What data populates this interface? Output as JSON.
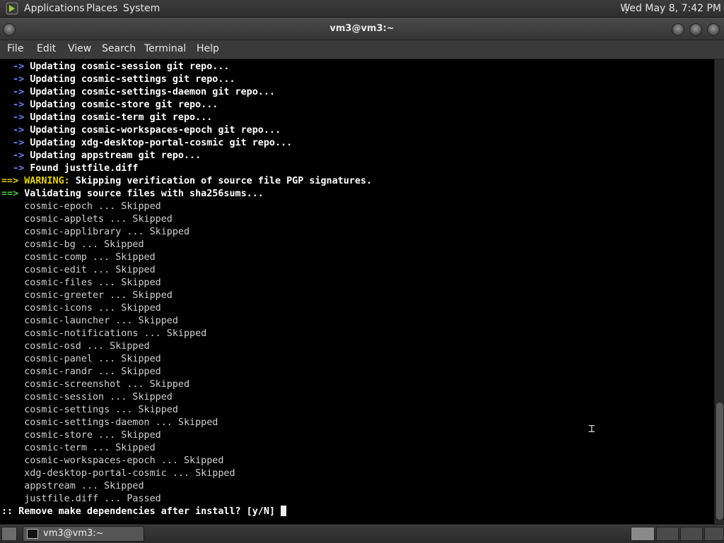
{
  "top_panel": {
    "menus": [
      "Applications",
      "Places",
      "System"
    ],
    "clock": "Wed May 8, 7:42 PM"
  },
  "window": {
    "title": "vm3@vm3:~",
    "menubar": [
      "File",
      "Edit",
      "View",
      "Search",
      "Terminal",
      "Help"
    ]
  },
  "terminal": {
    "lines": [
      {
        "kind": "arrow",
        "prefix": "  -> ",
        "text": "Updating cosmic-session git repo..."
      },
      {
        "kind": "arrow",
        "prefix": "  -> ",
        "text": "Updating cosmic-settings git repo..."
      },
      {
        "kind": "arrow",
        "prefix": "  -> ",
        "text": "Updating cosmic-settings-daemon git repo..."
      },
      {
        "kind": "arrow",
        "prefix": "  -> ",
        "text": "Updating cosmic-store git repo..."
      },
      {
        "kind": "arrow",
        "prefix": "  -> ",
        "text": "Updating cosmic-term git repo..."
      },
      {
        "kind": "arrow",
        "prefix": "  -> ",
        "text": "Updating cosmic-workspaces-epoch git repo..."
      },
      {
        "kind": "arrow",
        "prefix": "  -> ",
        "text": "Updating xdg-desktop-portal-cosmic git repo..."
      },
      {
        "kind": "arrow",
        "prefix": "  -> ",
        "text": "Updating appstream git repo..."
      },
      {
        "kind": "arrow",
        "prefix": "  -> ",
        "text": "Found justfile.diff"
      },
      {
        "kind": "warning",
        "prefix": "==> ",
        "label": "WARNING:",
        "text": " Skipping verification of source file PGP signatures."
      },
      {
        "kind": "green",
        "prefix": "==> ",
        "text": "Validating source files with sha256sums..."
      },
      {
        "kind": "plain",
        "text": "    cosmic-epoch ... Skipped"
      },
      {
        "kind": "plain",
        "text": "    cosmic-applets ... Skipped"
      },
      {
        "kind": "plain",
        "text": "    cosmic-applibrary ... Skipped"
      },
      {
        "kind": "plain",
        "text": "    cosmic-bg ... Skipped"
      },
      {
        "kind": "plain",
        "text": "    cosmic-comp ... Skipped"
      },
      {
        "kind": "plain",
        "text": "    cosmic-edit ... Skipped"
      },
      {
        "kind": "plain",
        "text": "    cosmic-files ... Skipped"
      },
      {
        "kind": "plain",
        "text": "    cosmic-greeter ... Skipped"
      },
      {
        "kind": "plain",
        "text": "    cosmic-icons ... Skipped"
      },
      {
        "kind": "plain",
        "text": "    cosmic-launcher ... Skipped"
      },
      {
        "kind": "plain",
        "text": "    cosmic-notifications ... Skipped"
      },
      {
        "kind": "plain",
        "text": "    cosmic-osd ... Skipped"
      },
      {
        "kind": "plain",
        "text": "    cosmic-panel ... Skipped"
      },
      {
        "kind": "plain",
        "text": "    cosmic-randr ... Skipped"
      },
      {
        "kind": "plain",
        "text": "    cosmic-screenshot ... Skipped"
      },
      {
        "kind": "plain",
        "text": "    cosmic-session ... Skipped"
      },
      {
        "kind": "plain",
        "text": "    cosmic-settings ... Skipped"
      },
      {
        "kind": "plain",
        "text": "    cosmic-settings-daemon ... Skipped"
      },
      {
        "kind": "plain",
        "text": "    cosmic-store ... Skipped"
      },
      {
        "kind": "plain",
        "text": "    cosmic-term ... Skipped"
      },
      {
        "kind": "plain",
        "text": "    cosmic-workspaces-epoch ... Skipped"
      },
      {
        "kind": "plain",
        "text": "    xdg-desktop-portal-cosmic ... Skipped"
      },
      {
        "kind": "plain",
        "text": "    appstream ... Skipped"
      },
      {
        "kind": "plain",
        "text": "    justfile.diff ... Passed"
      },
      {
        "kind": "prompt",
        "text": ":: Remove make dependencies after install? [y/N] "
      }
    ]
  },
  "taskbar": {
    "task_label": "vm3@vm3:~"
  },
  "colors": {
    "arrow": "#5f87ff",
    "green": "#4ec94e",
    "warning": "#e6d400",
    "terminal_bg": "#000000"
  },
  "icons": [
    "distro-logo-icon",
    "window-menu-icon",
    "minimize-icon",
    "maximize-icon",
    "close-icon",
    "show-desktop-icon",
    "terminal-task-icon",
    "text-cursor-icon"
  ]
}
